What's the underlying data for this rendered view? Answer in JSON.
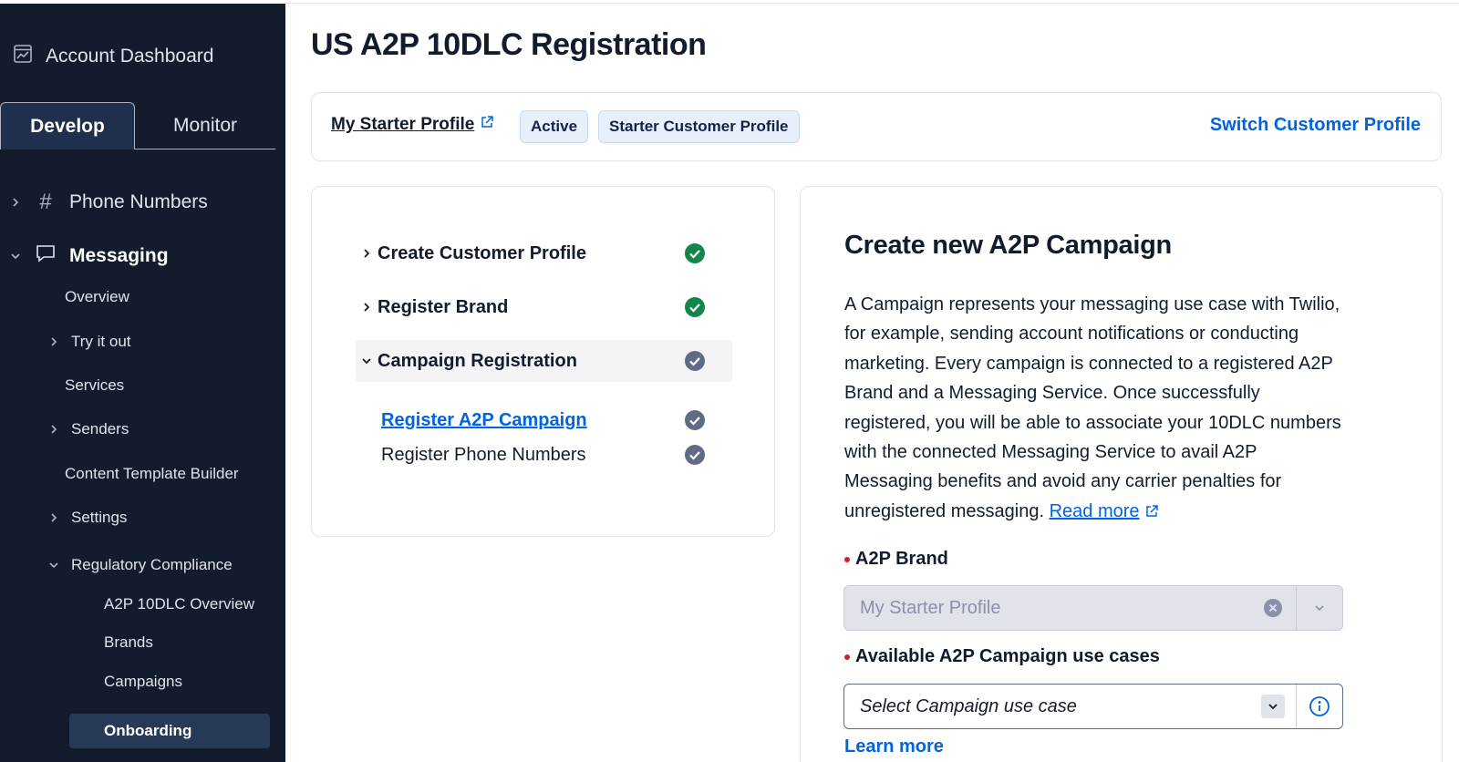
{
  "sidebar": {
    "account_dashboard": "Account Dashboard",
    "tabs": {
      "develop": "Develop",
      "monitor": "Monitor"
    },
    "phone_numbers": "Phone Numbers",
    "messaging": "Messaging",
    "items": {
      "overview": "Overview",
      "try_it_out": "Try it out",
      "services": "Services",
      "senders": "Senders",
      "content_template_builder": "Content Template Builder",
      "settings": "Settings",
      "regulatory_compliance": "Regulatory Compliance"
    },
    "compliance_items": {
      "a2p_overview": "A2P 10DLC Overview",
      "brands": "Brands",
      "campaigns": "Campaigns",
      "onboarding": "Onboarding"
    }
  },
  "page": {
    "title": "US A2P 10DLC Registration"
  },
  "profile": {
    "name": "My Starter Profile",
    "status_badge": "Active",
    "type_badge": "Starter Customer Profile",
    "switch_link": "Switch Customer Profile"
  },
  "steps": {
    "create_profile": "Create Customer Profile",
    "register_brand": "Register Brand",
    "campaign_registration": "Campaign Registration",
    "register_campaign": "Register A2P Campaign",
    "register_numbers": "Register Phone Numbers"
  },
  "form": {
    "title": "Create new A2P Campaign",
    "description": "A Campaign represents your messaging use case with Twilio, for example, sending account notifications or conducting marketing. Every campaign is connected to a registered A2P Brand and a Messaging Service. Once successfully registered, you will be able to associate your 10DLC numbers with the connected Messaging Service to avail A2P Messaging benefits and avoid any carrier penalties for unregistered messaging.",
    "read_more": "Read more",
    "brand_label": "A2P Brand",
    "brand_value": "My Starter Profile",
    "use_case_label": "Available A2P Campaign use cases",
    "use_case_placeholder": "Select Campaign use case",
    "learn_more": "Learn more"
  },
  "colors": {
    "sidebar_bg": "#121c2d",
    "link_blue": "#0263e0",
    "success_green": "#14854b",
    "pending_gray": "#606b85"
  }
}
